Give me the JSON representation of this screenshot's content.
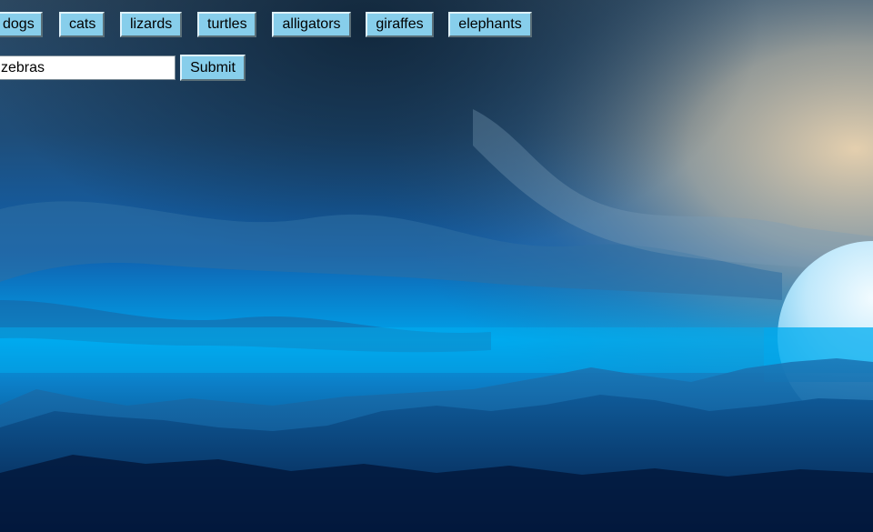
{
  "nav": {
    "buttons": [
      {
        "label": "dogs"
      },
      {
        "label": "cats"
      },
      {
        "label": "lizards"
      },
      {
        "label": "turtles"
      },
      {
        "label": "alligators"
      },
      {
        "label": "giraffes"
      },
      {
        "label": "elephants"
      }
    ]
  },
  "search": {
    "value": "zebras",
    "submit_label": "Submit"
  },
  "colors": {
    "button_bg": "#87ceeb",
    "input_bg": "#ffffff"
  }
}
